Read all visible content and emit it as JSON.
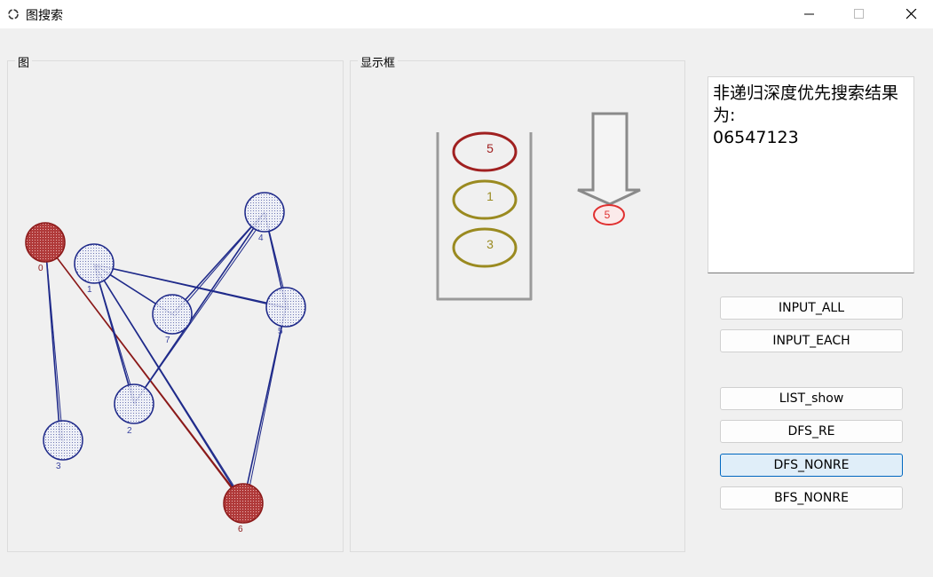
{
  "window": {
    "title": "图搜索"
  },
  "panels": {
    "graph_title": "图",
    "display_title": "显示框"
  },
  "graph": {
    "nodes": [
      {
        "id": "0",
        "label": "0",
        "state": "visited"
      },
      {
        "id": "1",
        "label": "1",
        "state": "unvisited"
      },
      {
        "id": "2",
        "label": "2",
        "state": "unvisited"
      },
      {
        "id": "3",
        "label": "3",
        "state": "unvisited"
      },
      {
        "id": "4",
        "label": "4",
        "state": "unvisited"
      },
      {
        "id": "5",
        "label": "5",
        "state": "unvisited"
      },
      {
        "id": "6",
        "label": "6",
        "state": "visited"
      },
      {
        "id": "7",
        "label": "7",
        "state": "unvisited"
      }
    ],
    "edges": [
      {
        "from": "0",
        "to": "3"
      },
      {
        "from": "0",
        "to": "6",
        "state": "traversed"
      },
      {
        "from": "1",
        "to": "2"
      },
      {
        "from": "1",
        "to": "5"
      },
      {
        "from": "1",
        "to": "6"
      },
      {
        "from": "1",
        "to": "7"
      },
      {
        "from": "2",
        "to": "4"
      },
      {
        "from": "4",
        "to": "7"
      },
      {
        "from": "4",
        "to": "5"
      },
      {
        "from": "5",
        "to": "6"
      }
    ],
    "colors": {
      "visited_fill": "#a83232",
      "visited_stroke": "#8b1a1a",
      "unvisited_fill": "#e6e8f2",
      "unvisited_stroke": "#1f2a8a",
      "edge": "#1f2a8a",
      "traversed_edge": "#8b1a1a"
    }
  },
  "stack": {
    "items": [
      "5",
      "1",
      "3"
    ],
    "item_colors": [
      "#a02020",
      "#9a8a20",
      "#9a8a20"
    ],
    "popped": "5",
    "popped_color": "#e03030"
  },
  "result": {
    "text": "非递归深度优先搜索结果为:",
    "sequence": "06547123"
  },
  "buttons": {
    "input_all": "INPUT_ALL",
    "input_each": "INPUT_EACH",
    "list_show": "LIST_show",
    "dfs_re": "DFS_RE",
    "dfs_nonre": "DFS_NONRE",
    "bfs_nonre": "BFS_NONRE"
  }
}
